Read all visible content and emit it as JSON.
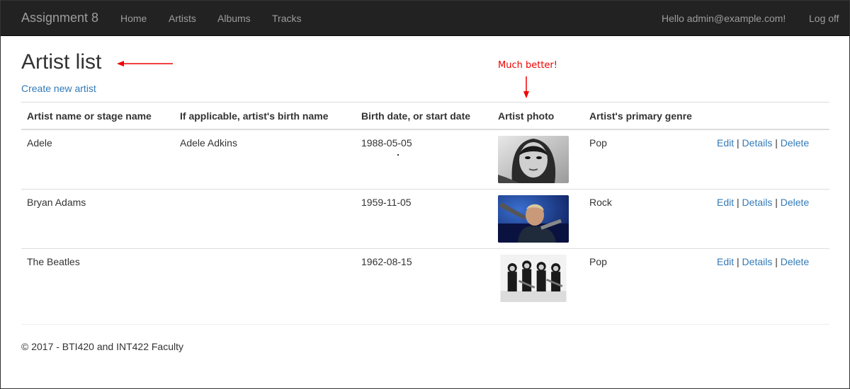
{
  "navbar": {
    "brand": "Assignment 8",
    "links": [
      "Home",
      "Artists",
      "Albums",
      "Tracks"
    ],
    "greeting": "Hello admin@example.com!",
    "logoff": "Log off"
  },
  "page": {
    "title": "Artist list",
    "create_link": "Create new artist",
    "annotation": "Much better!"
  },
  "table": {
    "headers": [
      "Artist name or stage name",
      "If applicable, artist's birth name",
      "Birth date, or start date",
      "Artist photo",
      "Artist's primary genre"
    ],
    "rows": [
      {
        "name": "Adele",
        "birth_name": "Adele Adkins",
        "date": "1988-05-05",
        "photo_icon": "adele-photo",
        "genre": "Pop"
      },
      {
        "name": "Bryan Adams",
        "birth_name": "",
        "date": "1959-11-05",
        "photo_icon": "bryan-adams-photo",
        "genre": "Rock"
      },
      {
        "name": "The Beatles",
        "birth_name": "",
        "date": "1962-08-15",
        "photo_icon": "beatles-photo",
        "genre": "Pop"
      }
    ],
    "actions": {
      "edit": "Edit",
      "details": "Details",
      "delete": "Delete",
      "separator": "|"
    }
  },
  "footer": {
    "text": "© 2017 - BTI420 and INT422 Faculty"
  },
  "colors": {
    "navbar_bg": "#222222",
    "link": "#337ab7",
    "annotation": "#ee0000"
  }
}
